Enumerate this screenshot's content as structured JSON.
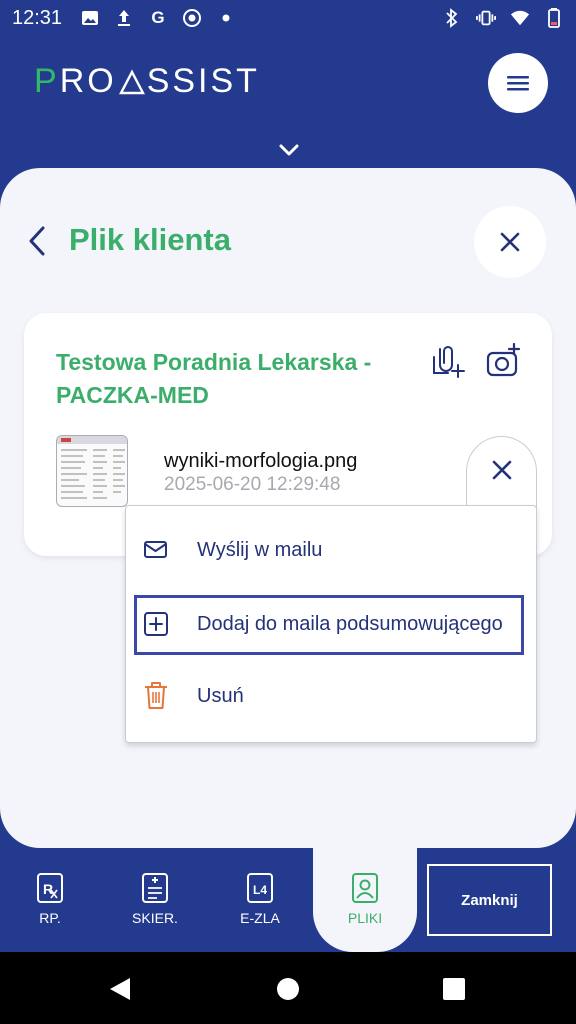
{
  "status_bar": {
    "time": "12:31",
    "left_icons": [
      "image-icon",
      "upload-icon",
      "google-icon",
      "chrome-icon",
      "dot-icon"
    ],
    "right_icons": [
      "bluetooth-icon",
      "vibrate-icon",
      "wifi-icon",
      "battery-icon"
    ]
  },
  "header": {
    "logo_text": "PROASSIST",
    "logo_parts": {
      "p": "P",
      "ro": "RO",
      "ssist": "SSIST"
    },
    "menu_icon": "hamburger-icon",
    "collapse_icon": "chevron-down-icon"
  },
  "page": {
    "title": "Plik klienta",
    "back_icon": "chevron-left-icon",
    "close_icon": "close-icon"
  },
  "card": {
    "client_name": "Testowa Poradnia Lekarska - PACZKA-MED",
    "actions": [
      "attach-file-icon",
      "add-photo-icon"
    ],
    "file": {
      "name": "wyniki-morfologia.png",
      "date": "2025-06-20 12:29:48"
    }
  },
  "popup_menu": {
    "items": [
      {
        "label": "Wyślij w mailu",
        "icon": "mail-icon"
      },
      {
        "label": "Dodaj do maila podsumowującego",
        "icon": "plus-square-icon",
        "highlighted": true
      },
      {
        "label": "Usuń",
        "icon": "trash-icon"
      }
    ]
  },
  "bottom_nav": {
    "items": [
      {
        "label": "RP.",
        "icon": "prescription-icon"
      },
      {
        "label": "SKIER.",
        "icon": "referral-icon"
      },
      {
        "label": "E-ZLA",
        "icon": "l4-document-icon"
      },
      {
        "label": "PLIKI",
        "icon": "user-file-icon",
        "active": true
      }
    ],
    "close_label": "Zamknij"
  },
  "colors": {
    "brand_blue": "#233a8e",
    "accent_green": "#3cae6b",
    "delete_orange": "#e8763a",
    "highlight_border": "#3a49a9"
  }
}
